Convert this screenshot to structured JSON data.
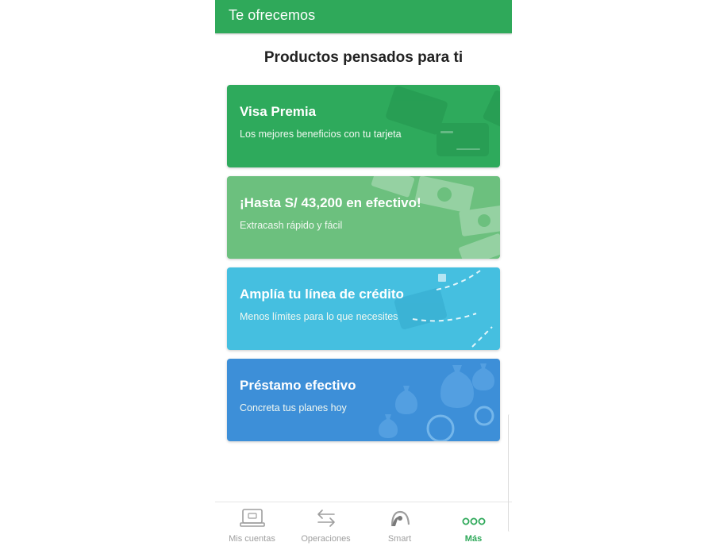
{
  "header": {
    "title": "Te ofrecemos"
  },
  "main": {
    "section_title": "Productos pensados para ti",
    "cards": [
      {
        "title": "Visa Premia",
        "subtitle": "Los mejores beneficios con tu tarjeta",
        "color": "#2eaa5c",
        "icon": "credit-card-icon"
      },
      {
        "title": "¡Hasta S/ 43,200 en efectivo!",
        "subtitle": "Extracash rápido y fácil",
        "color": "#6cc07e",
        "icon": "banknotes-icon"
      },
      {
        "title": "Amplía tu línea de crédito",
        "subtitle": "Menos límites para lo que necesites",
        "color": "#45bfe0",
        "icon": "card-upgrade-icon"
      },
      {
        "title": "Préstamo efectivo",
        "subtitle": "Concreta tus planes hoy",
        "color": "#3d8fd8",
        "icon": "money-bag-icon"
      }
    ]
  },
  "bottom_nav": {
    "items": [
      {
        "label": "Mis cuentas",
        "icon": "accounts-icon",
        "active": false
      },
      {
        "label": "Operaciones",
        "icon": "transfer-arrows-icon",
        "active": false
      },
      {
        "label": "Smart",
        "icon": "smart-icon",
        "active": false
      },
      {
        "label": "Más",
        "icon": "more-dots-icon",
        "active": true
      }
    ]
  },
  "colors": {
    "brand_green": "#2fa95a",
    "inactive_gray": "#9e9e9e"
  }
}
